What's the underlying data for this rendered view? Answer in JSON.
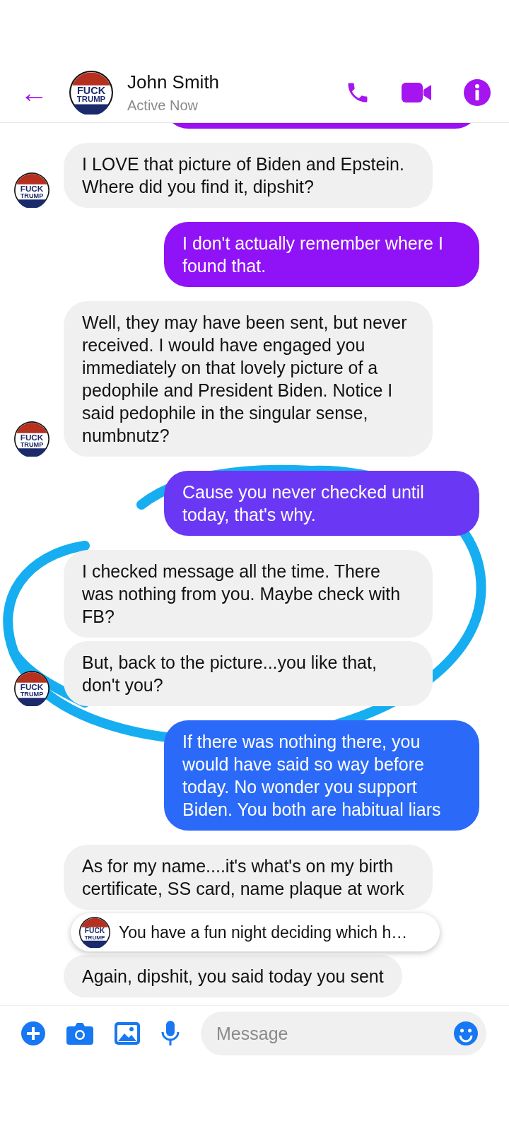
{
  "header": {
    "back": "←",
    "name": "John Smith",
    "status": "Active Now",
    "avatar": {
      "top": "FUCK",
      "bottom": "TRUMP"
    }
  },
  "messages": [
    {
      "kind": "outgoing",
      "color": "#9a10f2"
    },
    {
      "kind": "incoming",
      "avatar": {
        "top": "FUCK",
        "bottom": "TRUMP"
      },
      "bubbles": [
        "I LOVE that picture of Biden and Epstein. Where did you find it, dipshit?"
      ]
    },
    {
      "kind": "outgoing",
      "color": "#9012f6",
      "bubbles": [
        "I don't actually remember where I found that."
      ]
    },
    {
      "kind": "incoming",
      "avatar": {
        "top": "FUCK",
        "bottom": "TRUMP"
      },
      "bubbles": [
        "Well, they may have been sent, but never received. I would have engaged you immediately on that lovely picture of a pedophile and President Biden. Notice I said pedophile in the singular sense, numbnutz?"
      ]
    },
    {
      "kind": "outgoing",
      "color": "#6a38f5",
      "bubbles": [
        "Cause you never checked until today, that's why."
      ]
    },
    {
      "kind": "incoming",
      "avatar": {
        "top": "FUCK",
        "bottom": "TRUMP"
      },
      "bubbles": [
        "I checked message all the time. There was nothing from you. Maybe check with FB?",
        "But, back to the picture...you like that, don't you?"
      ]
    },
    {
      "kind": "outgoing",
      "color": "#2b6af8",
      "bubbles": [
        "If there was nothing there, you would have said so way before today. No wonder you support Biden. You both are habitual liars"
      ]
    },
    {
      "kind": "incoming",
      "bubbles": [
        "As for my name....it's what's on my birth certificate, SS card, name plaque at work",
        "Again, dipshit, you said today you sent"
      ]
    }
  ],
  "new_message_preview": {
    "avatar": {
      "top": "FUCK",
      "bottom": "TRUMP"
    },
    "text": "You have a fun night deciding which h…"
  },
  "composer": {
    "placeholder": "Message"
  }
}
